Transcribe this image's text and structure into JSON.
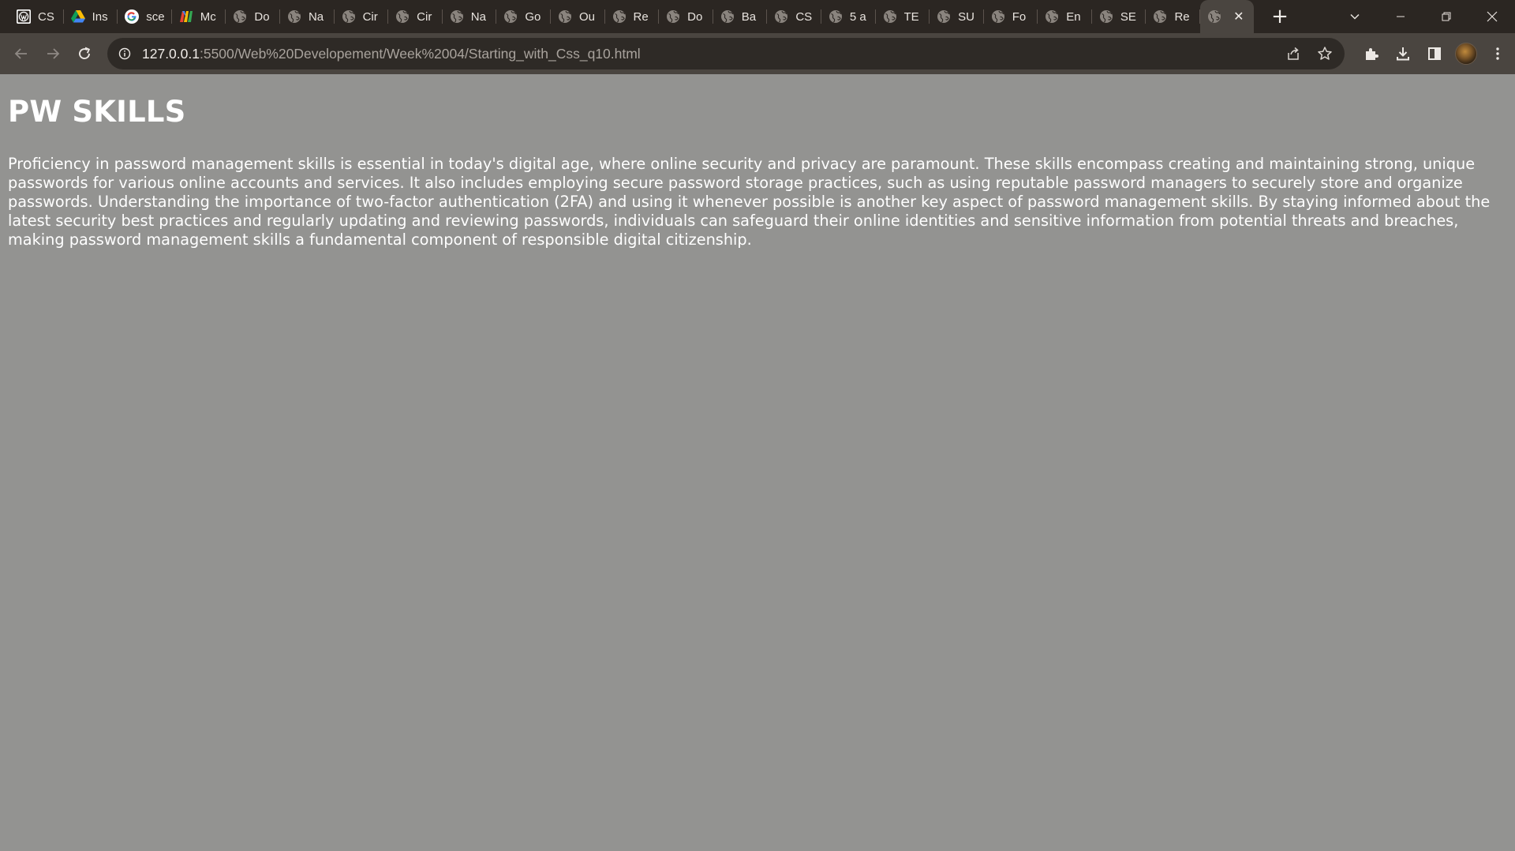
{
  "tabs": [
    {
      "title": "CS",
      "icon": "wordpress-icon"
    },
    {
      "title": "Ins",
      "icon": "google-drive-icon"
    },
    {
      "title": "sce",
      "icon": "google-icon"
    },
    {
      "title": "Mc",
      "icon": "colorful-m-icon"
    },
    {
      "title": "Do",
      "icon": "globe-icon"
    },
    {
      "title": "Na",
      "icon": "globe-icon"
    },
    {
      "title": "Cir",
      "icon": "globe-icon"
    },
    {
      "title": "Cir",
      "icon": "globe-icon"
    },
    {
      "title": "Na",
      "icon": "globe-icon"
    },
    {
      "title": "Go",
      "icon": "globe-icon"
    },
    {
      "title": "Ou",
      "icon": "globe-icon"
    },
    {
      "title": "Re",
      "icon": "globe-icon"
    },
    {
      "title": "Do",
      "icon": "globe-icon"
    },
    {
      "title": "Ba",
      "icon": "globe-icon"
    },
    {
      "title": "CS",
      "icon": "globe-icon"
    },
    {
      "title": "5 a",
      "icon": "globe-icon"
    },
    {
      "title": "TE",
      "icon": "globe-icon"
    },
    {
      "title": "SU",
      "icon": "globe-icon"
    },
    {
      "title": "Fo",
      "icon": "globe-icon"
    },
    {
      "title": "En",
      "icon": "globe-icon"
    },
    {
      "title": "SE",
      "icon": "globe-icon"
    },
    {
      "title": "Re",
      "icon": "globe-icon"
    }
  ],
  "active_tab": {
    "title": "",
    "icon": "globe-icon",
    "close": "✕"
  },
  "new_tab": "+",
  "address_bar": {
    "host": "127.0.0.1",
    "path": ":5500/Web%20Developement/Week%2004/Starting_with_Css_q10.html"
  },
  "page": {
    "heading": "PW SKILLS",
    "paragraph": "Proficiency in password management skills is essential in today's digital age, where online security and privacy are paramount. These skills encompass creating and maintaining strong, unique passwords for various online accounts and services. It also includes employing secure password storage practices, such as using reputable password managers to securely store and organize passwords. Understanding the importance of two-factor authentication (2FA) and using it whenever possible is another key aspect of password management skills. By staying informed about the latest security best practices and regularly updating and reviewing passwords, individuals can safeguard their online identities and sensitive information from potential threats and breaches, making password management skills a fundamental component of responsible digital citizenship."
  },
  "colors": {
    "tabstrip": "#2b2622",
    "toolbar": "#4a4540",
    "omnibox": "#2e2a26",
    "page_background": "#939391",
    "page_text": "#ffffff"
  }
}
